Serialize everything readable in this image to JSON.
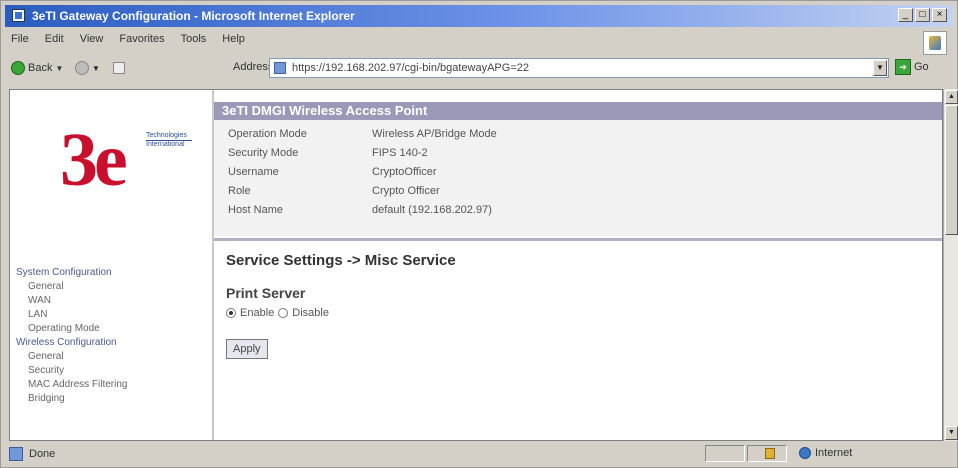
{
  "window": {
    "title": "3eTI Gateway Configuration - Microsoft Internet Explorer",
    "buttons": [
      "_",
      "□",
      "×"
    ]
  },
  "menubar": [
    "File",
    "Edit",
    "View",
    "Favorites",
    "Tools",
    "Help"
  ],
  "toolbar": {
    "back_label": "Back",
    "address_label": "Address",
    "url": "https://192.168.202.97/cgi-bin/bgatewayAPG=22",
    "go_label": "Go"
  },
  "logo": {
    "mark": "3e",
    "tag1": "Technologies",
    "tag2": "International"
  },
  "nav": {
    "items": [
      {
        "label": "System Configuration",
        "level": 0
      },
      {
        "label": "General",
        "level": 1
      },
      {
        "label": "WAN",
        "level": 1
      },
      {
        "label": "LAN",
        "level": 1
      },
      {
        "label": "Operating Mode",
        "level": 1
      },
      {
        "label": "Wireless Configuration",
        "level": 0
      },
      {
        "label": "General",
        "level": 1
      },
      {
        "label": "Security",
        "level": 1
      },
      {
        "label": "MAC Address Filtering",
        "level": 1
      },
      {
        "label": "Bridging",
        "level": 1
      }
    ]
  },
  "info": {
    "header": "3eTI DMGI Wireless Access Point",
    "rows": [
      {
        "key": "Operation Mode",
        "value": "Wireless AP/Bridge Mode"
      },
      {
        "key": "Security Mode",
        "value": "FIPS 140-2"
      },
      {
        "key": "Username",
        "value": "CryptoOfficer"
      },
      {
        "key": "Role",
        "value": "Crypto Officer"
      },
      {
        "key": "Host Name",
        "value": "default (192.168.202.97)"
      }
    ]
  },
  "content": {
    "page_title": "Service Settings -> Misc Service",
    "section_title": "Print Server",
    "enable_label": "Enable",
    "disable_label": "Disable",
    "selected": "enable",
    "apply_label": "Apply"
  },
  "statusbar": {
    "status_text": "Done",
    "zone_text": "Internet"
  }
}
